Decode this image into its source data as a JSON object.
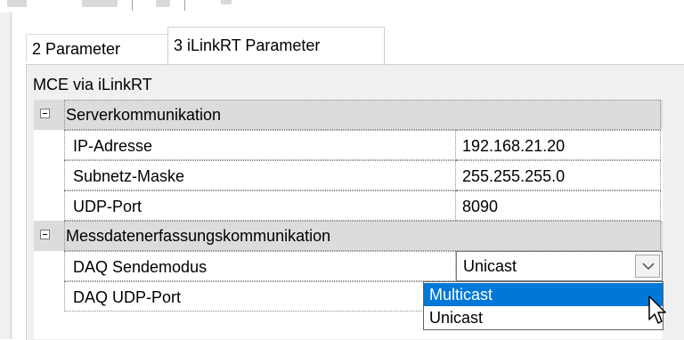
{
  "tabs": [
    {
      "label": "2 Parameter",
      "active": false
    },
    {
      "label": "3 iLinkRT  Parameter",
      "active": true
    }
  ],
  "group_label": "MCE via iLinkRT",
  "categories": [
    {
      "label": "Serverkommunikation",
      "expanded": true,
      "properties": [
        {
          "name": "IP-Adresse",
          "value": "192.168.21.20"
        },
        {
          "name": "Subnetz-Maske",
          "value": "255.255.255.0"
        },
        {
          "name": "UDP-Port",
          "value": "8090"
        }
      ]
    },
    {
      "label": "Messdatenerfassungskommunikation",
      "expanded": true,
      "properties": [
        {
          "name": "DAQ Sendemodus",
          "value": "Unicast"
        },
        {
          "name": "DAQ UDP-Port",
          "value": ""
        }
      ]
    }
  ],
  "dropdown": {
    "options": [
      "Multicast",
      "Unicast"
    ],
    "highlighted": "Multicast"
  },
  "colors": {
    "selection": "#0078d7",
    "category_bg": "#dcdcdc",
    "panel_bg": "#f0f0f0"
  },
  "icons": [
    "expander-minus-icon",
    "chevron-down-icon",
    "mouse-pointer-icon"
  ]
}
